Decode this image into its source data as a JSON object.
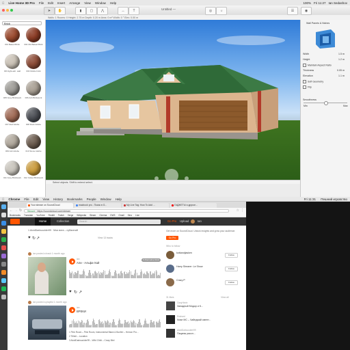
{
  "app": {
    "menubar": {
      "apple": "",
      "app_name": "Live Home 3D Pro",
      "items": [
        "File",
        "Edit",
        "Insert",
        "Arrange",
        "View",
        "Window",
        "Help"
      ],
      "right": [
        "100%",
        "Fri 11:27",
        "Ian Sedashov"
      ]
    },
    "window_title": "Untitled —",
    "toolbar_labels": [
      "Select",
      "Pan",
      "Wall",
      "Room",
      "Roof",
      "Dimension",
      "Text",
      "Camera",
      "Lighting",
      "Library",
      "Preview"
    ],
    "subbar": "Walls: 1 Rooms: 0  Height: 2.75 m  Depth: 0.20 m  Area: 0 m²  Width: 0 °  Elev: 0.00 m",
    "library": {
      "category": "Brick",
      "items": [
        {
          "name": "001 Baked Brick",
          "color": "#9a4a2e"
        },
        {
          "name": "002 Old Baked Brick",
          "color": "#8a3b24"
        },
        {
          "name": "003 light-ash. wall",
          "color": "#c9c1b5"
        },
        {
          "name": "004 Mottle brick",
          "color": "#8c4b36"
        },
        {
          "name": "005 Grey Brickwork",
          "color": "#9c9a95"
        },
        {
          "name": "006 Ash Brickwork",
          "color": "#a79e92"
        },
        {
          "name": "007 Red Adobe",
          "color": "#a06a55"
        },
        {
          "name": "008 Rock Adobe",
          "color": "#4c4f55"
        },
        {
          "name": "009 Ash Adobe",
          "color": "#b0a89c"
        },
        {
          "name": "010 Stone Adobe",
          "color": "#6b5b4e"
        },
        {
          "name": "011 Grey Brickwork",
          "color": "#c7c3bb"
        },
        {
          "name": "012 Yellow Brickwork",
          "color": "#c99a3c"
        }
      ]
    },
    "status": "Select objects. Shift to extend select.",
    "props": {
      "header": "Wall Panels & Niches",
      "rows": [
        {
          "label": "Width",
          "value": "1.5 m"
        },
        {
          "label": "Height",
          "value": "1.2 m"
        },
        {
          "label": "Maintain Aspect Ratio",
          "value": ""
        },
        {
          "label": "Thickness",
          "value": "0.05 m"
        },
        {
          "label": "Elevation",
          "value": "1.1 m"
        },
        {
          "label": "Soft Geometry",
          "value": ""
        },
        {
          "label": "Flip",
          "value": ""
        }
      ],
      "smoothness_label": "Smoothness",
      "smoothness_min": "Min",
      "smoothness_max": "Max",
      "smoothness_level": 0.5
    }
  },
  "browser": {
    "mac_menubar": {
      "app_name": "Chrome",
      "items": [
        "File",
        "Edit",
        "View",
        "History",
        "Bookmarks",
        "People",
        "Window",
        "Help"
      ],
      "right": [
        "Fri 11:31",
        "Пешний игровство"
      ]
    },
    "tabs": [
      {
        "title": "Your stream on SoundCloud",
        "favicon": "#f50",
        "active": true
      },
      {
        "title": "macbook pro - Поиск в G...",
        "favicon": "#4285f4",
        "active": false
      },
      {
        "title": "My Live Tag: How To Add ...",
        "favicon": "#c33",
        "active": false
      },
      {
        "title": "ГАДЖЕТЫ и другое...",
        "favicon": "#e00",
        "active": false
      }
    ],
    "secure": "Secure",
    "url": "https://soundcloud.com/stream",
    "bookmarks": [
      "Bookmarks",
      "Translate",
      "YouTube",
      "Reddit",
      "Twitch",
      "Verge",
      "Wikipedia",
      "Steam",
      "Cinema",
      "DW3",
      "Gmail",
      "Kino",
      "Live"
    ],
    "nav": {
      "home": "Home",
      "collection": "Collection",
      "search_placeholder": "Search",
      "gopro": "Go Pro",
      "upload": "Upload",
      "user": "Ian"
    },
    "feed": [
      {
        "type": "reply",
        "text": "1 AlcidDarksoulder99 · Моя вота – субагатий"
      },
      {
        "type": "more",
        "text": "View 13 tracks"
      },
      {
        "type": "post",
        "user": "ian",
        "action": "posted a track",
        "time": "1 month ago",
        "artist": "ian",
        "title": "Али - Альфа-Хай",
        "tag": "# Alternative Rock"
      },
      {
        "type": "post",
        "user": "ian",
        "action": "posted a playlist",
        "time": "1 month ago",
        "artist": "ian",
        "title": "ВРЕКИ",
        "tag": ""
      }
    ],
    "playlist_rows": [
      "1 Pink Room – Pink Room, Instrumental Black & Bonfire – Hemon Pro...",
      "2 Tiëstö – Location",
      "3 AlcidDarksoulder99 – Wild Child – Crazy Bird"
    ],
    "sidebar": {
      "gopro_text": "Get more on SoundCloud. Unlock insights and grow your audience.",
      "gopro_btn": "Go Pro",
      "who_to_follow": "Who to follow",
      "view_all": "View all",
      "follow_label": "Follow",
      "suggestions": [
        {
          "name": "kotkandjasken",
          "color": "#7a5c3a"
        },
        {
          "name": "Harry Shearer: Le Show",
          "color": "#5a6d8a"
        },
        {
          "name": "Crazy P",
          "color": "#8a6a4a"
        }
      ],
      "likes_header": "31 likes",
      "likes": [
        {
          "user": "OzzyHimin",
          "title": "Западный Модор и К...",
          "color": "#444"
        },
        {
          "user": "Eminard",
          "title": "Nose MC – Чайнджай смент...",
          "color": "#222"
        },
        {
          "user": "AlcidDarksoulder99",
          "title": "Пацаны рассл...",
          "color": "#333"
        }
      ]
    }
  }
}
